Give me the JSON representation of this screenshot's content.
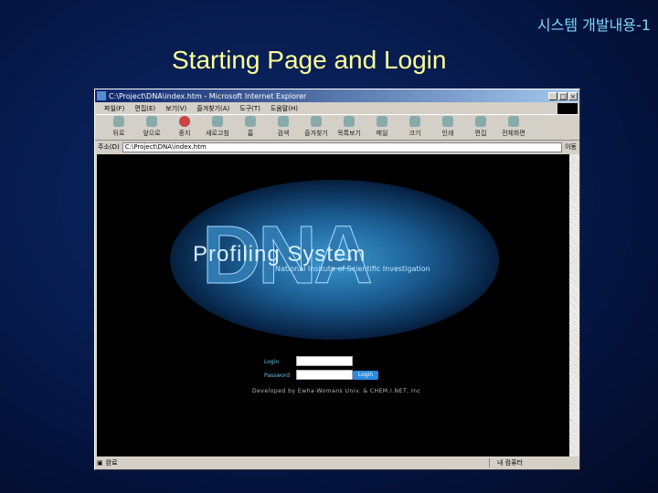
{
  "slide": {
    "title": "시스템 개발내용-1",
    "heading": "Starting Page and Login"
  },
  "browser": {
    "title": "C:\\Project\\DNA\\index.htm - Microsoft Internet Explorer",
    "menu": [
      "파일(F)",
      "편집(E)",
      "보기(V)",
      "즐겨찾기(A)",
      "도구(T)",
      "도움말(H)"
    ],
    "toolbar": [
      "뒤로",
      "앞으로",
      "중지",
      "새로고침",
      "홈",
      "검색",
      "즐겨찾기",
      "목록보기",
      "메일",
      "크기",
      "인쇄",
      "편집",
      "전체화면"
    ],
    "address_label": "주소(D)",
    "address": "C:\\Project\\DNA\\index.htm",
    "go": "이동",
    "status": "완료",
    "zone": "내 컴퓨터"
  },
  "page": {
    "logo": "DNA",
    "app_name": "Profiling System",
    "institute": "National Insitute of Scientific Investigation",
    "login_label": "Login",
    "password_label": "Password",
    "login_button": "Login",
    "credit": "Developed by Ewha-Womans Univ. & CHEM.I.NET, Inc"
  },
  "colors": {
    "accent": "#2a8ae0",
    "title_bar": "#0a246a"
  }
}
